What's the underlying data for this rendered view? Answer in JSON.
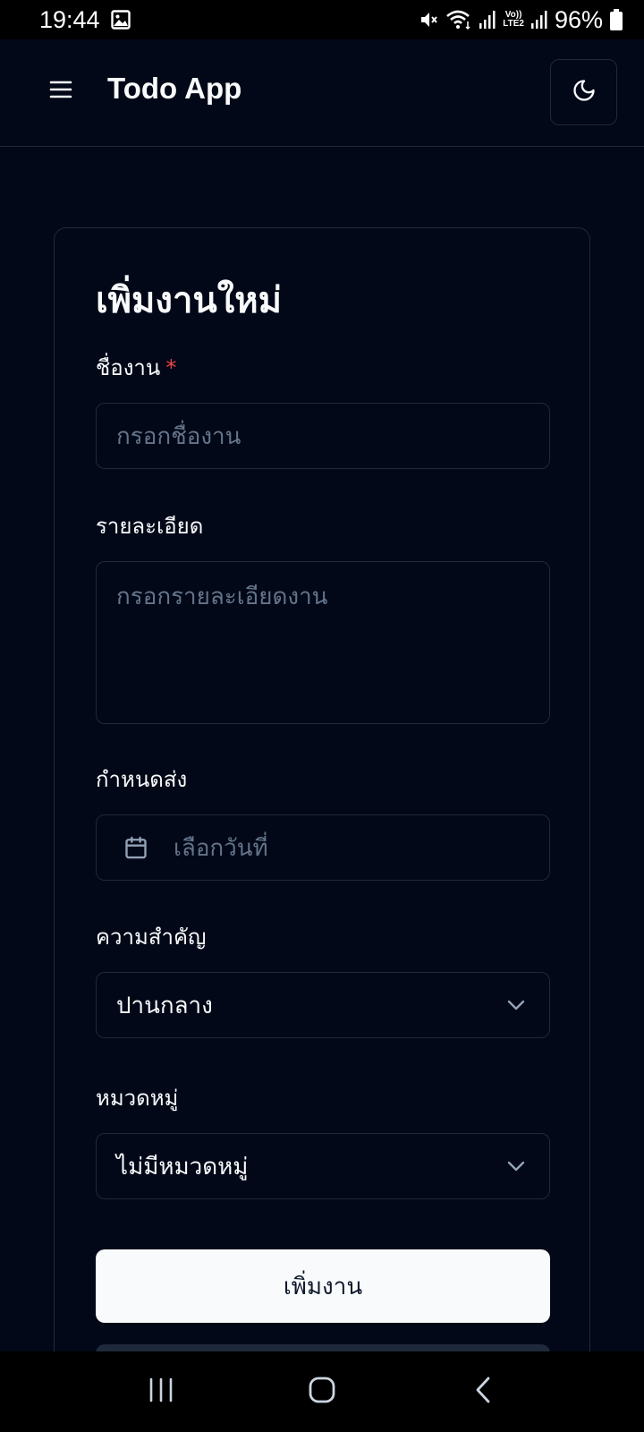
{
  "status_bar": {
    "time": "19:44",
    "battery": "96%",
    "lte_top": "Vo))",
    "lte_bottom": "LTE2",
    "icons": [
      "gallery-icon",
      "mute-icon",
      "wifi-icon",
      "signal-icon",
      "signal-icon",
      "battery-icon"
    ]
  },
  "header": {
    "title": "Todo App",
    "menu_icon": "hamburger-menu-icon",
    "theme_icon": "moon-icon"
  },
  "form": {
    "title": "เพิ่มงานใหม่",
    "name": {
      "label": "ชื่องาน",
      "required_mark": "*",
      "placeholder": "กรอกชื่องาน"
    },
    "details": {
      "label": "รายละเอียด",
      "placeholder": "กรอกรายละเอียดงาน"
    },
    "due": {
      "label": "กำหนดส่ง",
      "placeholder": "เลือกวันที่",
      "icon": "calendar-icon"
    },
    "priority": {
      "label": "ความสำคัญ",
      "value": "ปานกลาง"
    },
    "category": {
      "label": "หมวดหมู่",
      "value": "ไม่มีหมวดหมู่"
    },
    "submit_label": "เพิ่มงาน"
  },
  "colors": {
    "background": "#020817",
    "border": "#1e293b",
    "primary_button": "#f8fafc",
    "required": "#ef4444",
    "placeholder": "#64748b"
  },
  "nav_bar": {
    "icons": [
      "recent-apps-icon",
      "home-icon",
      "back-icon"
    ]
  }
}
